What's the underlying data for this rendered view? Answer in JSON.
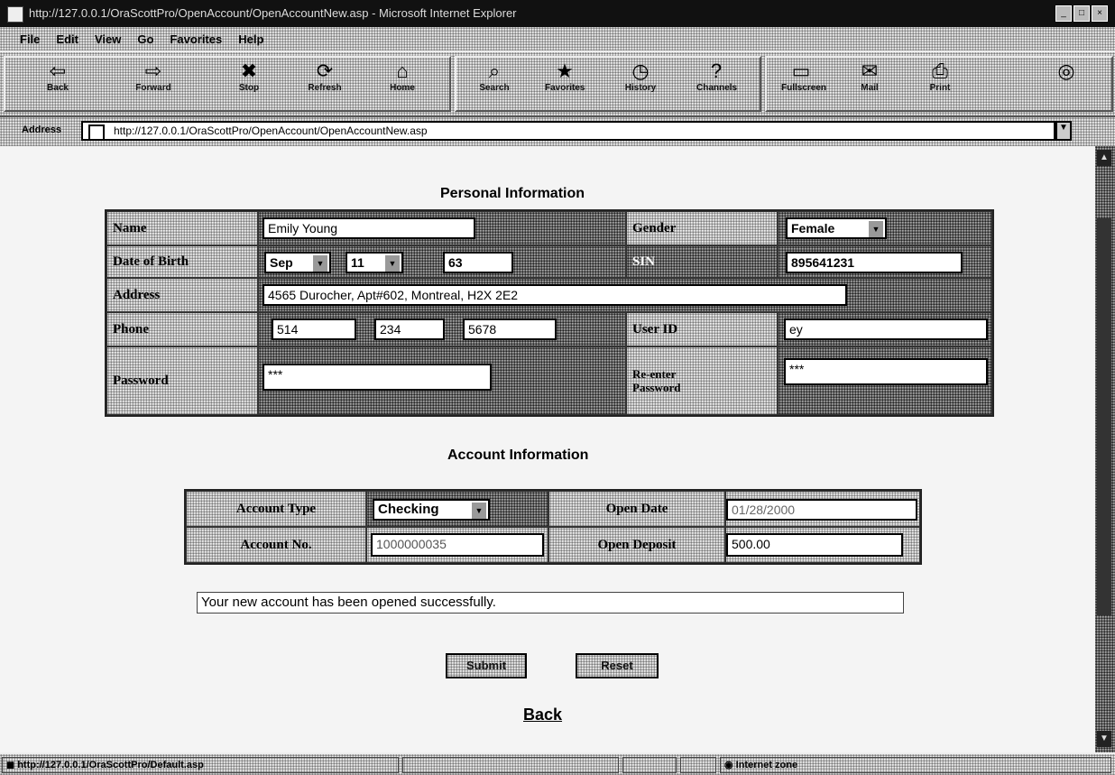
{
  "window": {
    "title": "http://127.0.0.1/OraScottPro/OpenAccount/OpenAccountNew.asp - Microsoft Internet Explorer"
  },
  "menu": {
    "items": [
      "File",
      "Edit",
      "View",
      "Go",
      "Favorites",
      "Help"
    ]
  },
  "toolbar": {
    "buttons": [
      {
        "label": "Back",
        "icon": "back-arrow-icon"
      },
      {
        "label": "Forward",
        "icon": "forward-arrow-icon"
      },
      {
        "label": "Stop",
        "icon": "stop-icon"
      },
      {
        "label": "Refresh",
        "icon": "refresh-icon"
      },
      {
        "label": "Home",
        "icon": "home-icon"
      },
      {
        "label": "Search",
        "icon": "search-icon"
      },
      {
        "label": "Favorites",
        "icon": "favorites-icon"
      },
      {
        "label": "History",
        "icon": "history-icon"
      },
      {
        "label": "Channels",
        "icon": "channels-icon"
      },
      {
        "label": "Fullscreen",
        "icon": "fullscreen-icon"
      },
      {
        "label": "Mail",
        "icon": "mail-icon"
      },
      {
        "label": "Print",
        "icon": "print-icon"
      }
    ]
  },
  "address": {
    "label": "Address",
    "url": "http://127.0.0.1/OraScottPro/OpenAccount/OpenAccountNew.asp"
  },
  "personal": {
    "title": "Personal Information",
    "name_label": "Name",
    "name_value": "Emily Young",
    "gender_label": "Gender",
    "gender_value": "Female",
    "dob_label": "Date of Birth",
    "dob_month": "Sep",
    "dob_day": "11",
    "dob_year": "63",
    "sin_label": "SIN",
    "sin_value": "895641231",
    "address_label": "Address",
    "address_value": "4565 Durocher, Apt#602, Montreal, H2X 2E2",
    "phone_label": "Phone",
    "phone_area": "514",
    "phone_prefix": "234",
    "phone_line": "5678",
    "userid_label": "User ID",
    "userid_value": "ey",
    "password_label": "Password",
    "password_value": "***",
    "reenter_label": "Re-enter Password",
    "reenter_value": "***"
  },
  "account": {
    "title": "Account Information",
    "type_label": "Account Type",
    "type_value": "Checking",
    "open_date_label": "Open Date",
    "open_date_value": "01/28/2000",
    "number_label": "Account No.",
    "number_value": "1000000035",
    "deposit_label": "Open Deposit",
    "deposit_value": "500.00"
  },
  "message": "Your new account has been opened successfully.",
  "buttons": {
    "submit": "Submit",
    "reset": "Reset"
  },
  "back_link": "Back",
  "status": {
    "url": "http://127.0.0.1/OraScottPro/Default.asp",
    "zone": "Internet zone"
  }
}
